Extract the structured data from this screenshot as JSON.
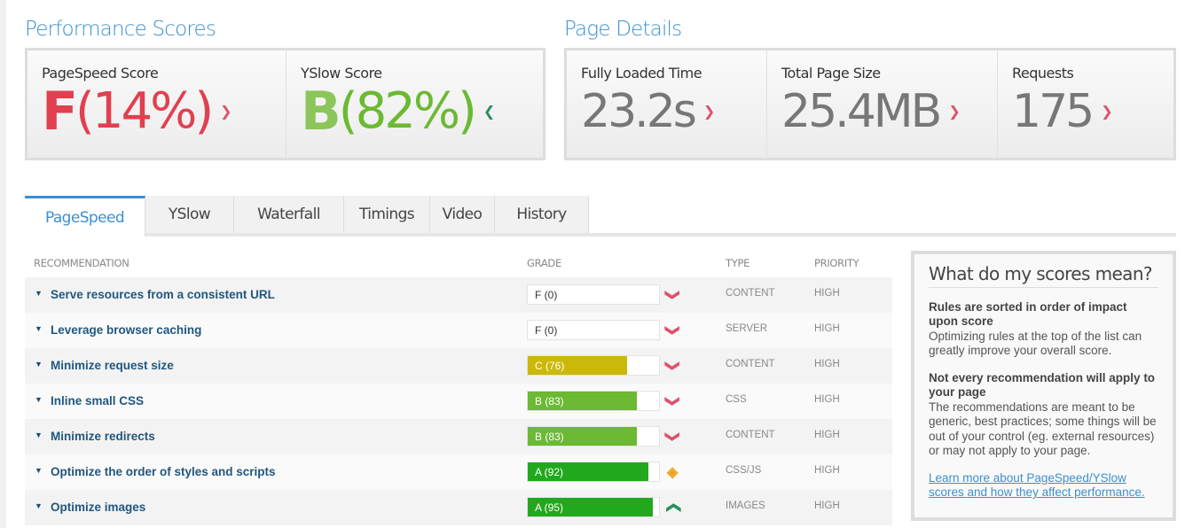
{
  "performance": {
    "title": "Performance Scores",
    "pagespeed": {
      "label": "PageSpeed Score",
      "grade": "F",
      "percent": "(14%)",
      "trend": "down"
    },
    "yslow": {
      "label": "YSlow Score",
      "grade": "B",
      "percent": "(82%)",
      "trend": "up"
    }
  },
  "details": {
    "title": "Page Details",
    "items": [
      {
        "label": "Fully Loaded Time",
        "value": "23.2s",
        "trend": "down"
      },
      {
        "label": "Total Page Size",
        "value": "25.4MB",
        "trend": "down"
      },
      {
        "label": "Requests",
        "value": "175",
        "trend": "down"
      }
    ]
  },
  "tabs": [
    "PageSpeed",
    "YSlow",
    "Waterfall",
    "Timings",
    "Video",
    "History"
  ],
  "table": {
    "headers": {
      "recommendation": "RECOMMENDATION",
      "grade": "GRADE",
      "type": "TYPE",
      "priority": "PRIORITY"
    },
    "rows": [
      {
        "name": "Serve resources from a consistent URL",
        "grade": "F (0)",
        "score": 0,
        "color": "#ffffff",
        "icon": "down",
        "type": "CONTENT",
        "priority": "HIGH"
      },
      {
        "name": "Leverage browser caching",
        "grade": "F (0)",
        "score": 0,
        "color": "#ffffff",
        "icon": "down",
        "type": "SERVER",
        "priority": "HIGH"
      },
      {
        "name": "Minimize request size",
        "grade": "C (76)",
        "score": 76,
        "color": "#cbb80a",
        "icon": "down",
        "type": "CONTENT",
        "priority": "HIGH"
      },
      {
        "name": "Inline small CSS",
        "grade": "B (83)",
        "score": 83,
        "color": "#6cb933",
        "icon": "down",
        "type": "CSS",
        "priority": "HIGH"
      },
      {
        "name": "Minimize redirects",
        "grade": "B (83)",
        "score": 83,
        "color": "#6cb933",
        "icon": "down",
        "type": "CONTENT",
        "priority": "HIGH"
      },
      {
        "name": "Optimize the order of styles and scripts",
        "grade": "A (92)",
        "score": 92,
        "color": "#22a81c",
        "icon": "neutral",
        "type": "CSS/JS",
        "priority": "HIGH"
      },
      {
        "name": "Optimize images",
        "grade": "A (95)",
        "score": 95,
        "color": "#22a81c",
        "icon": "up",
        "type": "IMAGES",
        "priority": "HIGH"
      }
    ]
  },
  "sidebar": {
    "title": "What do my scores mean?",
    "p1_title": "Rules are sorted in order of impact upon score",
    "p1_text": "Optimizing rules at the top of the list can greatly improve your overall score.",
    "p2_title": "Not every recommendation will apply to your page",
    "p2_text": "The recommendations are meant to be generic, best practices; some things will be out of your control (eg. external resources) or may not apply to your page.",
    "link": "Learn more about PageSpeed/YSlow scores and how they affect performance."
  },
  "colors": {
    "accent": "#3c8fd0",
    "bad": "#e0404f",
    "good": "#6cb933",
    "down_icon": "#e0506a",
    "up_icon": "#2a8f5a",
    "neutral_icon": "#f0a020"
  }
}
